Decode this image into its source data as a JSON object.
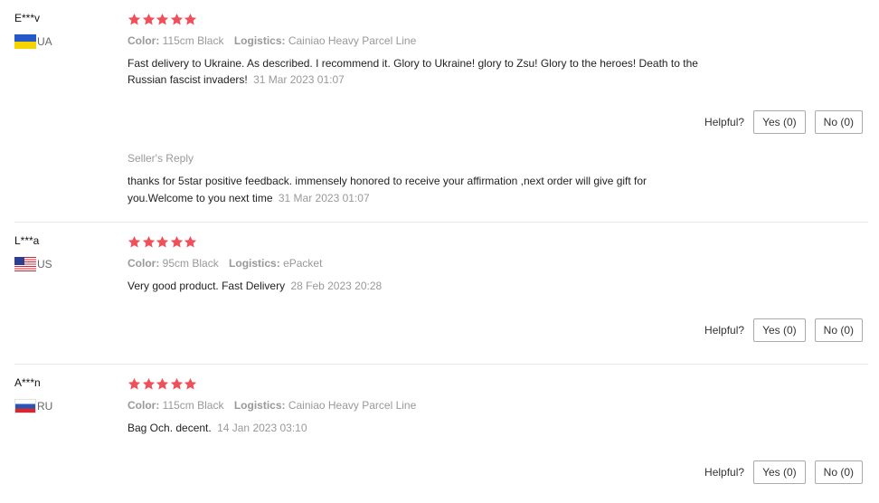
{
  "reviews": [
    {
      "user": "E***v",
      "country": "UA",
      "rating": 5,
      "color_label": "Color:",
      "color_value": "115cm Black",
      "logistics_label": "Logistics:",
      "logistics_value": "Cainiao Heavy Parcel Line",
      "text_line1": "Fast delivery to Ukraine. As described. I recommend it. Glory to Ukraine! glory to Zsu! Glory to the heroes! Death to the",
      "text_line2": "Russian fascist invaders!",
      "date": "31 Mar 2023 01:07",
      "helpful_label": "Helpful?",
      "yes_label": "Yes (0)",
      "no_label": "No (0)",
      "seller_reply_title": "Seller's Reply",
      "seller_reply_line1": "thanks for 5star positive feedback. immensely honored to receive your affirmation ,next order will give gift for",
      "seller_reply_line2": "you.Welcome to you next time",
      "seller_reply_date": "31 Mar 2023 01:07"
    },
    {
      "user": "L***a",
      "country": "US",
      "rating": 5,
      "color_label": "Color:",
      "color_value": "95cm Black",
      "logistics_label": "Logistics:",
      "logistics_value": "ePacket",
      "text": "Very good product. Fast Delivery",
      "date": "28 Feb 2023 20:28",
      "helpful_label": "Helpful?",
      "yes_label": "Yes (0)",
      "no_label": "No (0)"
    },
    {
      "user": "A***n",
      "country": "RU",
      "rating": 5,
      "color_label": "Color:",
      "color_value": "115cm Black",
      "logistics_label": "Logistics:",
      "logistics_value": "Cainiao Heavy Parcel Line",
      "text": "Bag Och. decent.",
      "date": "14 Jan 2023 03:10",
      "helpful_label": "Helpful?",
      "yes_label": "Yes (0)",
      "no_label": "No (0)"
    }
  ],
  "colors": {
    "star": "#f0505a",
    "muted_text": "#999999",
    "body_text": "#222222",
    "button_border": "#aaaaaa"
  },
  "icons": {
    "star": "star-icon",
    "flag_ua": "ukraine-flag-icon",
    "flag_us": "usa-flag-icon",
    "flag_ru": "russia-flag-icon"
  }
}
